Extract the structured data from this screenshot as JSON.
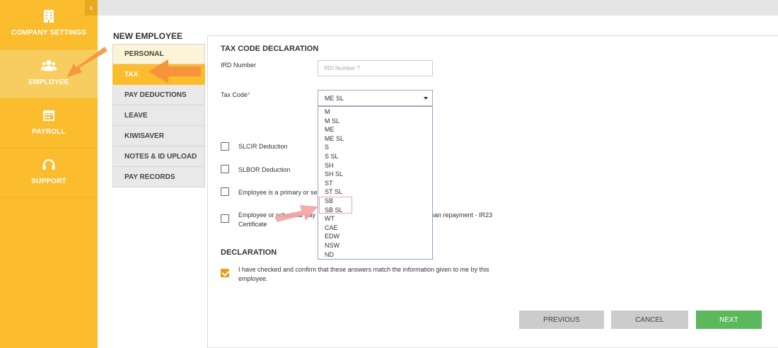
{
  "sidebar": {
    "items": [
      {
        "label": "COMPANY SETTINGS",
        "icon": "building-icon"
      },
      {
        "label": "EMPLOYEE",
        "icon": "users-icon"
      },
      {
        "label": "PAYROLL",
        "icon": "calendar-icon"
      },
      {
        "label": "SUPPORT",
        "icon": "headset-icon"
      }
    ],
    "collapse_glyph": "‹"
  },
  "page_title": "NEW EMPLOYEE",
  "subnav": [
    "PERSONAL",
    "TAX",
    "PAY DEDUCTIONS",
    "LEAVE",
    "KIWISAVER",
    "NOTES & ID UPLOAD",
    "PAY RECORDS"
  ],
  "form": {
    "section_title": "TAX CODE DECLARATION",
    "ird_label": "IRD Number",
    "ird_placeholder": "IRD Number ?",
    "taxcode_label": "Tax Code",
    "required_mark": "*",
    "taxcode_value": "ME SL",
    "taxcode_options": [
      "M",
      "M SL",
      "ME",
      "ME  SL",
      "S",
      "S SL",
      "SH",
      "SH SL",
      "ST",
      "ST SL",
      "SB",
      "SB SL",
      "WT",
      "CAE",
      "EDW",
      "NSW",
      "ND"
    ],
    "checkboxes": {
      "slcir": "SLCIR Deduction",
      "slbor": "SLBOR Deduction",
      "primary": "Employee is a primary or se",
      "schedular_a": "Employee or schedular pay",
      "schedular_b": "ent loan repayment - IR23",
      "schedular_c": "Certificate"
    },
    "declaration_title": "DECLARATION",
    "declaration_text_1": "I have checked and confirm that these answers match the information given to me by this",
    "declaration_text_2": "employee."
  },
  "buttons": {
    "previous": "PREVIOUS",
    "cancel": "CANCEL",
    "next": "NEXT"
  },
  "colors": {
    "brand": "#fbbc2e",
    "next": "#5cb85c",
    "arrow_orange": "#f5943a",
    "arrow_pink": "#f4a3a3"
  }
}
